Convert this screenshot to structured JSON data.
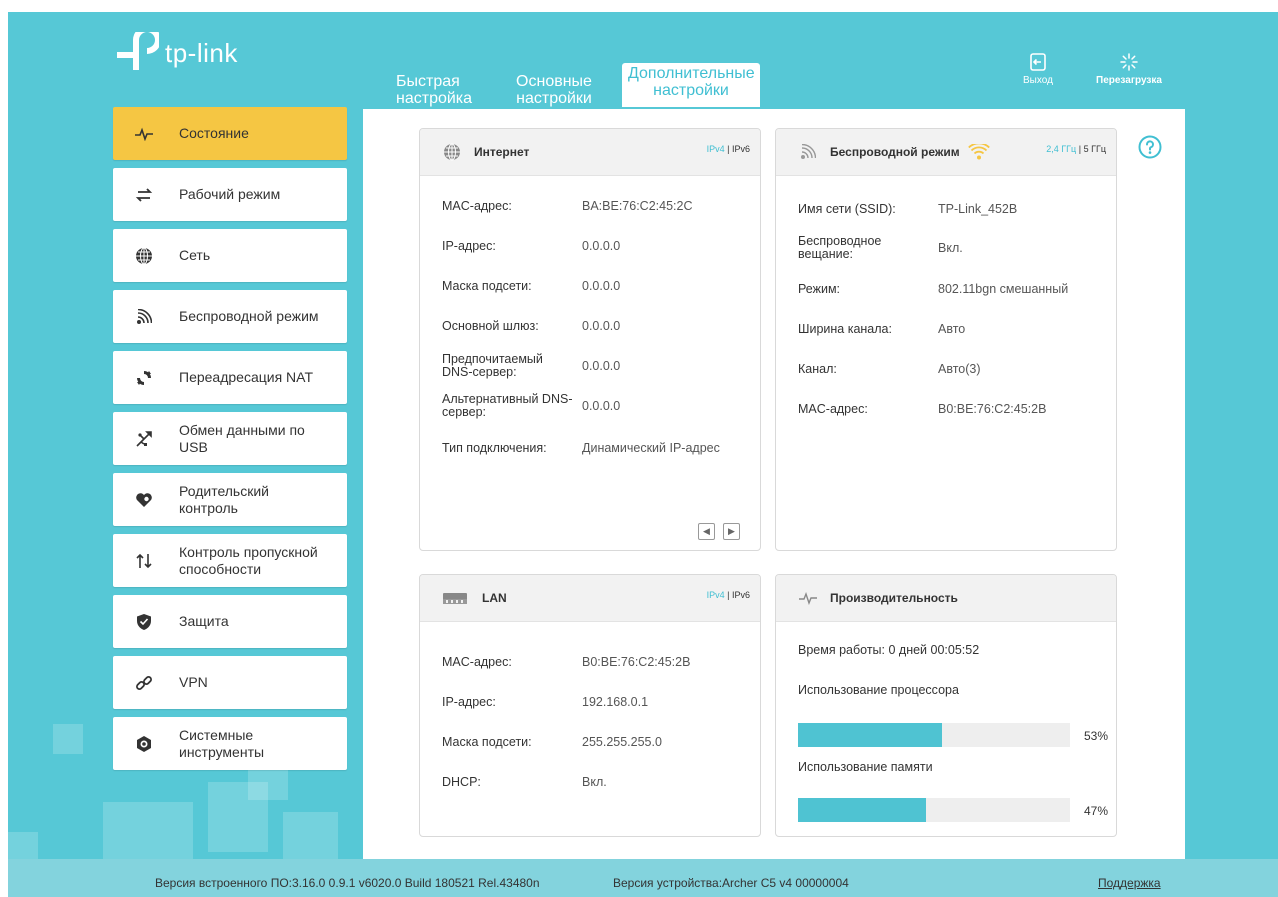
{
  "brand": {
    "name": "tp-link"
  },
  "tabs": [
    {
      "line1": "Быстрая",
      "line2": "настройка"
    },
    {
      "line1": "Основные",
      "line2": "настройки"
    },
    {
      "line1": "Дополнительные",
      "line2": "настройки"
    }
  ],
  "top_buttons": {
    "logout": "Выход",
    "reboot": "Перезагрузка"
  },
  "sidebar": {
    "items": [
      {
        "label": "Состояние",
        "icon": "pulse-icon"
      },
      {
        "label": "Рабочий режим",
        "icon": "swap-icon"
      },
      {
        "label": "Сеть",
        "icon": "globe-icon"
      },
      {
        "label": "Беспроводной режим",
        "icon": "wifi-icon"
      },
      {
        "label": "Переадресация NAT",
        "icon": "nat-icon"
      },
      {
        "label": "Обмен данными по USB",
        "icon": "usb-icon"
      },
      {
        "label": "Родительский контроль",
        "icon": "heart-icon"
      },
      {
        "label": "Контроль пропускной способности",
        "icon": "updown-arrows-icon"
      },
      {
        "label": "Защита",
        "icon": "shield-icon"
      },
      {
        "label": "VPN",
        "icon": "link-icon"
      },
      {
        "label": "Системные инструменты",
        "icon": "gear-icon"
      }
    ]
  },
  "internet": {
    "title": "Интернет",
    "ipv4": "IPv4",
    "sep": "|",
    "ipv6": "IPv6",
    "rows": [
      {
        "k": "MAC-адрес:",
        "v": "BA:BE:76:C2:45:2C"
      },
      {
        "k": "IP-адрес:",
        "v": "0.0.0.0"
      },
      {
        "k": "Маска подсети:",
        "v": "0.0.0.0"
      },
      {
        "k": "Основной шлюз:",
        "v": "0.0.0.0"
      },
      {
        "k": "Предпочитаемый DNS-сервер:",
        "v": "0.0.0.0"
      },
      {
        "k": "Альтернативный DNS-сервер:",
        "v": "0.0.0.0"
      },
      {
        "k": "Тип подключения:",
        "v": "Динамический IP-адрес"
      }
    ]
  },
  "wireless": {
    "title": "Беспроводной режим",
    "band24": "2,4 ГГц",
    "sep": "|",
    "band5": "5 ГГц",
    "rows": [
      {
        "k": "Имя сети (SSID):",
        "v": "TP-Link_452B"
      },
      {
        "k": "Беспроводное вещание:",
        "v": "Вкл."
      },
      {
        "k": "Режим:",
        "v": "802.11bgn смешанный"
      },
      {
        "k": "Ширина канала:",
        "v": "Авто"
      },
      {
        "k": "Канал:",
        "v": "Авто(3)"
      },
      {
        "k": "MAC-адрес:",
        "v": "B0:BE:76:C2:45:2B"
      }
    ]
  },
  "lan": {
    "title": "LAN",
    "ipv4": "IPv4",
    "sep": "|",
    "ipv6": "IPv6",
    "rows": [
      {
        "k": "MAC-адрес:",
        "v": "B0:BE:76:C2:45:2B"
      },
      {
        "k": "IP-адрес:",
        "v": "192.168.0.1"
      },
      {
        "k": "Маска подсети:",
        "v": "255.255.255.0"
      },
      {
        "k": "DHCP:",
        "v": "Вкл."
      }
    ]
  },
  "performance": {
    "title": "Производительность",
    "uptime": "Время работы: 0 дней 00:05:52",
    "cpu_label": "Использование процессора",
    "cpu_pct": "53%",
    "cpu_value": 0.53,
    "mem_label": "Использование памяти",
    "mem_pct": "47%",
    "mem_value": 0.47
  },
  "footer": {
    "firmware": "Версия встроенного ПО:3.16.0 0.9.1 v6020.0 Build 180521 Rel.43480n",
    "hardware": "Версия устройства:Archer C5 v4 00000004",
    "support": "Поддержка"
  },
  "colors": {
    "accent": "#40bfd2",
    "background": "#56c8d6",
    "active_nav": "#f5c643",
    "wifi_icon": "#f5c643"
  }
}
